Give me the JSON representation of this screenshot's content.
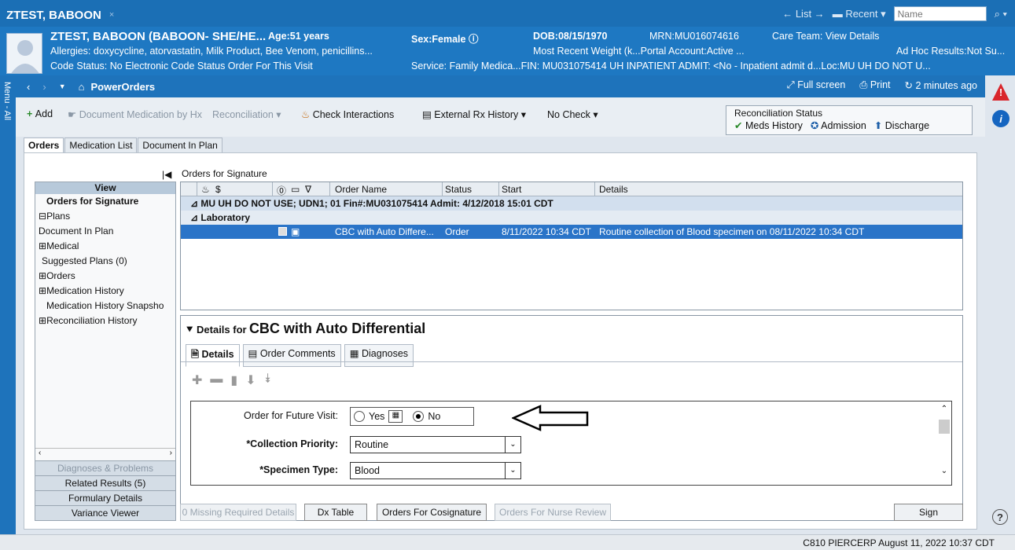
{
  "top": {
    "patient_tab": "ZTEST, BABOON",
    "close": "×",
    "list": "← List →",
    "recent": "Recent ▾",
    "name_placeholder": "Name"
  },
  "banner": {
    "name": "ZTEST, BABOON (BABOON- SHE/HE...",
    "age": "Age:51 years",
    "sex": "Sex:Female",
    "dob": "DOB:08/15/1970",
    "mrn": "MRN:MU016074616",
    "care_team": "Care Team: View Details",
    "allergies": "Allergies: doxycycline, atorvastatin, Milk Product, Bee Venom, penicillins...",
    "weight": "Most Recent Weight (k...Portal Account:Active ...",
    "adhoc": "Ad Hoc Results:Not Su...",
    "code_status": "Code Status: No Electronic Code Status Order For This Visit",
    "service": "Service: Family Medica...FIN: MU031075414   UH INPATIENT   ADMIT: <No - Inpatient admit d...Loc:MU UH DO NOT U..."
  },
  "left_strip": "Menu - All",
  "nav": {
    "title": "PowerOrders",
    "full_screen": "Full screen",
    "print": "Print",
    "refresh": "2 minutes ago"
  },
  "toolbar": {
    "add": "Add",
    "document_medication": "Document Medication by Hx",
    "reconciliation": "Reconciliation ▾",
    "check_interactions": "Check Interactions",
    "external_rx": "External Rx History ▾",
    "no_check": "No Check ▾"
  },
  "recon_status": {
    "title": "Reconciliation Status",
    "meds_history": "Meds History",
    "admission": "Admission",
    "discharge": "Discharge"
  },
  "tabs": [
    "Orders",
    "Medication List",
    "Document In Plan"
  ],
  "view": {
    "header": "View",
    "items": [
      "Orders for Signature",
      "Plans",
      "Document In Plan",
      "Medical",
      "Suggested Plans (0)",
      "Orders",
      "Medication History",
      "Medication History Snapsho",
      "Reconciliation History"
    ],
    "bottom": [
      "Diagnoses & Problems",
      "Related Results (5)",
      "Formulary Details",
      "Variance Viewer"
    ]
  },
  "orders_for_signature": "Orders for Signature",
  "grid": {
    "columns": {
      "dollar": "$",
      "order_name": "Order Name",
      "status": "Status",
      "start": "Start",
      "details": "Details"
    },
    "group1": "⊿  MU UH DO NOT USE; UDN1; 01  Fin#:MU031075414  Admit: 4/12/2018 15:01 CDT",
    "group2": "⊿  Laboratory",
    "row": {
      "order_name": "CBC with Auto Differe...",
      "status": "Order",
      "start": "8/11/2022 10:34 CDT",
      "details": "Routine collection of Blood specimen on 08/11/2022 10:34 CDT"
    }
  },
  "details": {
    "prefix": "Details for",
    "title": "CBC with Auto Differential",
    "tabs": [
      "Details",
      "Order Comments",
      "Diagnoses"
    ]
  },
  "form": {
    "future_visit_label": "Order for Future Visit:",
    "yes": "Yes",
    "no": "No",
    "priority_label": "*Collection Priority:",
    "priority_value": "Routine",
    "specimen_label": "*Specimen Type:",
    "specimen_value": "Blood"
  },
  "buttons": {
    "missing": "0 Missing Required Details",
    "dx_table": "Dx Table",
    "cosign": "Orders For Cosignature",
    "nurse": "Orders For Nurse Review",
    "sign": "Sign"
  },
  "status_bar": "C810  PIERCERP  August 11, 2022  10:37 CDT",
  "colors": {
    "header_blue": "#1b6fb5",
    "selected_row": "#2a74c8",
    "alert_red": "#d9262c",
    "info_blue": "#1565c0"
  }
}
